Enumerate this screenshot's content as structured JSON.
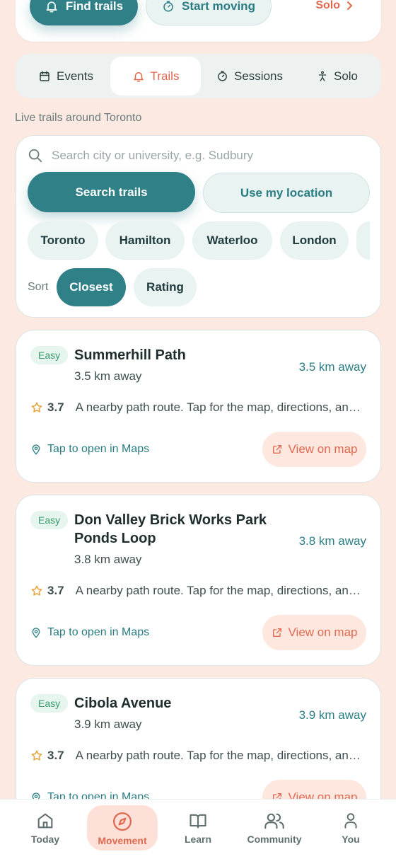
{
  "top_actions": {
    "find_trails": "Find trails",
    "start_moving": "Start moving",
    "solo": "Solo"
  },
  "tabs": [
    {
      "label": "Events",
      "icon": "calendar-icon"
    },
    {
      "label": "Trails",
      "icon": "bell-icon",
      "active": true
    },
    {
      "label": "Sessions",
      "icon": "stopwatch-icon"
    },
    {
      "label": "Solo",
      "icon": "person-icon"
    }
  ],
  "caption": "Live trails around Toronto",
  "search": {
    "placeholder": "Search city or university, e.g. Sudbury",
    "search_button": "Search trails",
    "location_button": "Use my location",
    "chips": [
      "Toronto",
      "Hamilton",
      "Waterloo",
      "London"
    ],
    "sort_label": "Sort",
    "sort_options": [
      {
        "label": "Closest",
        "active": true
      },
      {
        "label": "Rating",
        "active": false
      }
    ]
  },
  "trails": [
    {
      "difficulty": "Easy",
      "name": "Summerhill Path",
      "away": "3.5 km away",
      "away_right": "3.5 km away",
      "rating": "3.7",
      "description": "A nearby path route. Tap for the map, directions, and more.",
      "maps_link": "Tap to open in Maps",
      "view_button": "View on map"
    },
    {
      "difficulty": "Easy",
      "name": "Don Valley Brick Works Park Ponds Loop",
      "away": "3.8 km away",
      "away_right": "3.8 km away",
      "rating": "3.7",
      "description": "A nearby path route. Tap for the map, directions, and more.",
      "maps_link": "Tap to open in Maps",
      "view_button": "View on map"
    },
    {
      "difficulty": "Easy",
      "name": "Cibola Avenue",
      "away": "3.9 km away",
      "away_right": "3.9 km away",
      "rating": "3.7",
      "description": "A nearby path route. Tap for the map, directions, and more.",
      "maps_link": "Tap to open in Maps",
      "view_button": "View on map"
    }
  ],
  "bottom_nav": [
    {
      "label": "Today",
      "icon": "home-icon"
    },
    {
      "label": "Movement",
      "icon": "compass-icon",
      "active": true
    },
    {
      "label": "Learn",
      "icon": "book-icon"
    },
    {
      "label": "Community",
      "icon": "users-icon"
    },
    {
      "label": "You",
      "icon": "user-icon"
    }
  ],
  "colors": {
    "background": "#fce9e2",
    "primary_teal": "#2f8087",
    "accent_coral": "#e0694f",
    "chip_bg": "#e8f3f2"
  }
}
